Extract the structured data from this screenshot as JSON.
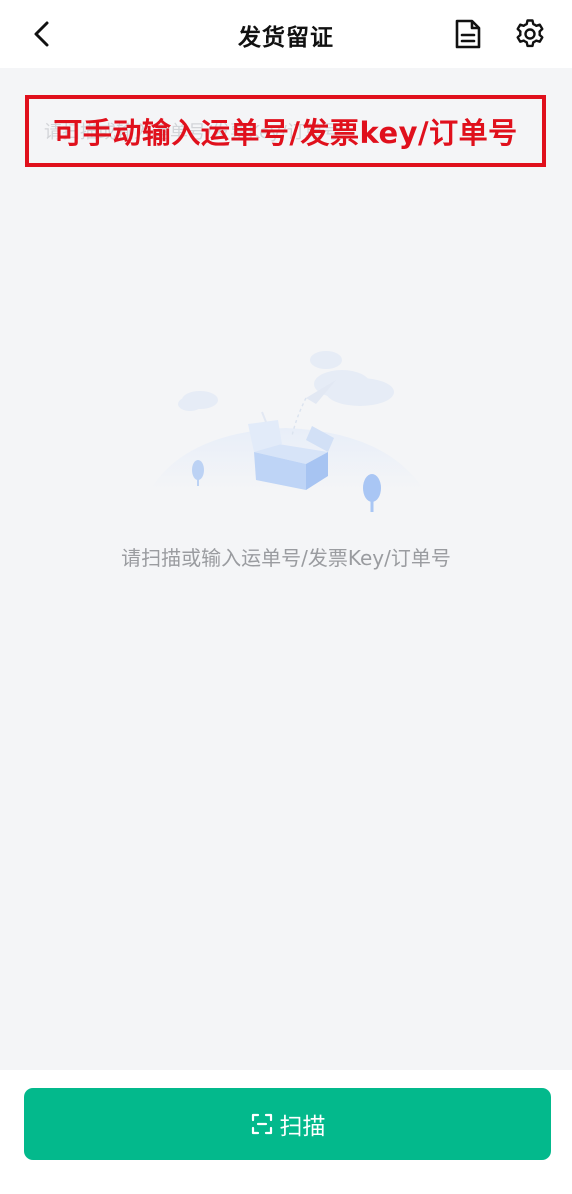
{
  "header": {
    "title": "发货留证",
    "back_icon": "chevron-left-icon",
    "document_icon": "document-icon",
    "settings_icon": "gear-icon"
  },
  "search": {
    "placeholder": "请扫描或输入运单号/发票Key/订单号"
  },
  "annotation": {
    "text": "可手动输入运单号/发票key/订单号",
    "color": "#e0101c"
  },
  "empty_state": {
    "illustration": "empty-box-illustration",
    "message": "请扫描或输入运单号/发票Key/订单号"
  },
  "footer": {
    "scan_label": "扫描",
    "scan_icon": "scan-icon",
    "button_color": "#03b98c"
  }
}
